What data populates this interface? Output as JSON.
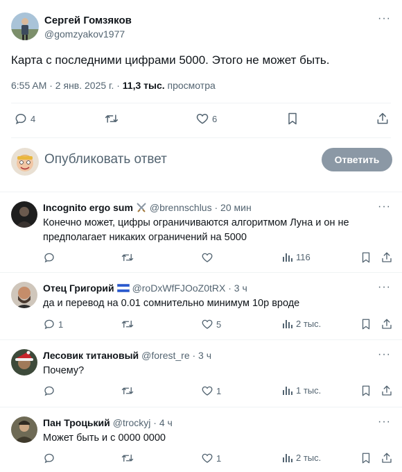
{
  "main_tweet": {
    "author_name": "Сергей Гомзяков",
    "author_handle": "@gomzyakov1977",
    "more": "···",
    "text": "Карта с последними цифрами 5000. Этого не может быть.",
    "time": "6:55 AM · 2 янв. 2025 г. · ",
    "views_count": "11,3 тыс.",
    "views_label": " просмотра",
    "stats": {
      "replies": "4",
      "retweets": "",
      "likes": "6"
    }
  },
  "reply_composer": {
    "placeholder": "Опубликовать ответ",
    "button_label": "Ответить"
  },
  "replies": [
    {
      "name": "Incognito ergo sum",
      "handle": "@brennschlus · 20 мин",
      "badge": "crossed-swords-icon",
      "text": "Конечно может, цифры ограничиваются алгоритмом Луна и он не предполагает никаких ограничений на 5000",
      "replies": "",
      "likes": "",
      "views": "116"
    },
    {
      "name": "Отец Григорий",
      "handle": "@roDxWfFJOoZ0tRX · 3 ч",
      "badge": "flag-icon",
      "text": "да и перевод на 0.01 сомнительно минимум 10р вроде",
      "replies": "1",
      "likes": "5",
      "views": "2 тыс."
    },
    {
      "name": "Лесовик титановый",
      "handle": "@forest_re · 3 ч",
      "badge": "",
      "text": "Почему?",
      "replies": "",
      "likes": "1",
      "views": "1 тыс."
    },
    {
      "name": "Пан Троцький",
      "handle": "@trockyj · 4 ч",
      "badge": "",
      "text": "Может быть и с 0000 0000",
      "replies": "",
      "likes": "1",
      "views": "2 тыс."
    }
  ],
  "colors": {
    "text": "#0f1419",
    "secondary": "#536471",
    "divider": "#eff3f4",
    "reply_button": "#8b98a5"
  }
}
